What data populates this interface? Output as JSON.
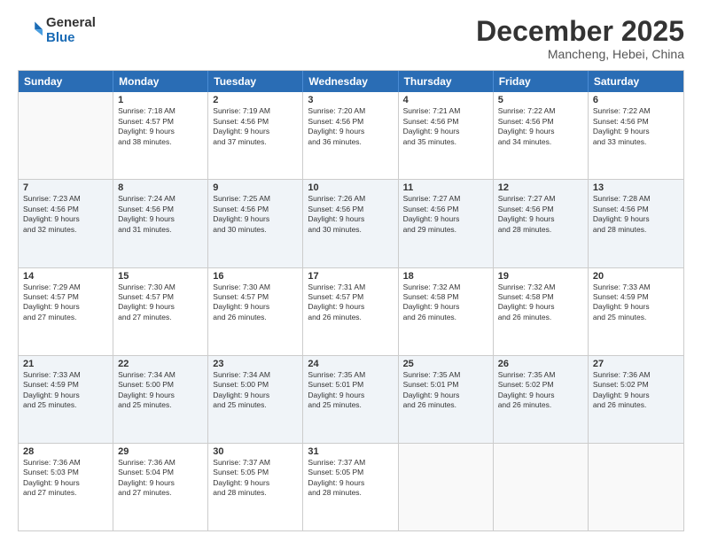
{
  "logo": {
    "general": "General",
    "blue": "Blue"
  },
  "title": "December 2025",
  "location": "Mancheng, Hebei, China",
  "days": [
    "Sunday",
    "Monday",
    "Tuesday",
    "Wednesday",
    "Thursday",
    "Friday",
    "Saturday"
  ],
  "weeks": [
    [
      {
        "day": "",
        "info": ""
      },
      {
        "day": "1",
        "info": "Sunrise: 7:18 AM\nSunset: 4:57 PM\nDaylight: 9 hours\nand 38 minutes."
      },
      {
        "day": "2",
        "info": "Sunrise: 7:19 AM\nSunset: 4:56 PM\nDaylight: 9 hours\nand 37 minutes."
      },
      {
        "day": "3",
        "info": "Sunrise: 7:20 AM\nSunset: 4:56 PM\nDaylight: 9 hours\nand 36 minutes."
      },
      {
        "day": "4",
        "info": "Sunrise: 7:21 AM\nSunset: 4:56 PM\nDaylight: 9 hours\nand 35 minutes."
      },
      {
        "day": "5",
        "info": "Sunrise: 7:22 AM\nSunset: 4:56 PM\nDaylight: 9 hours\nand 34 minutes."
      },
      {
        "day": "6",
        "info": "Sunrise: 7:22 AM\nSunset: 4:56 PM\nDaylight: 9 hours\nand 33 minutes."
      }
    ],
    [
      {
        "day": "7",
        "info": "Sunrise: 7:23 AM\nSunset: 4:56 PM\nDaylight: 9 hours\nand 32 minutes."
      },
      {
        "day": "8",
        "info": "Sunrise: 7:24 AM\nSunset: 4:56 PM\nDaylight: 9 hours\nand 31 minutes."
      },
      {
        "day": "9",
        "info": "Sunrise: 7:25 AM\nSunset: 4:56 PM\nDaylight: 9 hours\nand 30 minutes."
      },
      {
        "day": "10",
        "info": "Sunrise: 7:26 AM\nSunset: 4:56 PM\nDaylight: 9 hours\nand 30 minutes."
      },
      {
        "day": "11",
        "info": "Sunrise: 7:27 AM\nSunset: 4:56 PM\nDaylight: 9 hours\nand 29 minutes."
      },
      {
        "day": "12",
        "info": "Sunrise: 7:27 AM\nSunset: 4:56 PM\nDaylight: 9 hours\nand 28 minutes."
      },
      {
        "day": "13",
        "info": "Sunrise: 7:28 AM\nSunset: 4:56 PM\nDaylight: 9 hours\nand 28 minutes."
      }
    ],
    [
      {
        "day": "14",
        "info": "Sunrise: 7:29 AM\nSunset: 4:57 PM\nDaylight: 9 hours\nand 27 minutes."
      },
      {
        "day": "15",
        "info": "Sunrise: 7:30 AM\nSunset: 4:57 PM\nDaylight: 9 hours\nand 27 minutes."
      },
      {
        "day": "16",
        "info": "Sunrise: 7:30 AM\nSunset: 4:57 PM\nDaylight: 9 hours\nand 26 minutes."
      },
      {
        "day": "17",
        "info": "Sunrise: 7:31 AM\nSunset: 4:57 PM\nDaylight: 9 hours\nand 26 minutes."
      },
      {
        "day": "18",
        "info": "Sunrise: 7:32 AM\nSunset: 4:58 PM\nDaylight: 9 hours\nand 26 minutes."
      },
      {
        "day": "19",
        "info": "Sunrise: 7:32 AM\nSunset: 4:58 PM\nDaylight: 9 hours\nand 26 minutes."
      },
      {
        "day": "20",
        "info": "Sunrise: 7:33 AM\nSunset: 4:59 PM\nDaylight: 9 hours\nand 25 minutes."
      }
    ],
    [
      {
        "day": "21",
        "info": "Sunrise: 7:33 AM\nSunset: 4:59 PM\nDaylight: 9 hours\nand 25 minutes."
      },
      {
        "day": "22",
        "info": "Sunrise: 7:34 AM\nSunset: 5:00 PM\nDaylight: 9 hours\nand 25 minutes."
      },
      {
        "day": "23",
        "info": "Sunrise: 7:34 AM\nSunset: 5:00 PM\nDaylight: 9 hours\nand 25 minutes."
      },
      {
        "day": "24",
        "info": "Sunrise: 7:35 AM\nSunset: 5:01 PM\nDaylight: 9 hours\nand 25 minutes."
      },
      {
        "day": "25",
        "info": "Sunrise: 7:35 AM\nSunset: 5:01 PM\nDaylight: 9 hours\nand 26 minutes."
      },
      {
        "day": "26",
        "info": "Sunrise: 7:35 AM\nSunset: 5:02 PM\nDaylight: 9 hours\nand 26 minutes."
      },
      {
        "day": "27",
        "info": "Sunrise: 7:36 AM\nSunset: 5:02 PM\nDaylight: 9 hours\nand 26 minutes."
      }
    ],
    [
      {
        "day": "28",
        "info": "Sunrise: 7:36 AM\nSunset: 5:03 PM\nDaylight: 9 hours\nand 27 minutes."
      },
      {
        "day": "29",
        "info": "Sunrise: 7:36 AM\nSunset: 5:04 PM\nDaylight: 9 hours\nand 27 minutes."
      },
      {
        "day": "30",
        "info": "Sunrise: 7:37 AM\nSunset: 5:05 PM\nDaylight: 9 hours\nand 28 minutes."
      },
      {
        "day": "31",
        "info": "Sunrise: 7:37 AM\nSunset: 5:05 PM\nDaylight: 9 hours\nand 28 minutes."
      },
      {
        "day": "",
        "info": ""
      },
      {
        "day": "",
        "info": ""
      },
      {
        "day": "",
        "info": ""
      }
    ]
  ]
}
